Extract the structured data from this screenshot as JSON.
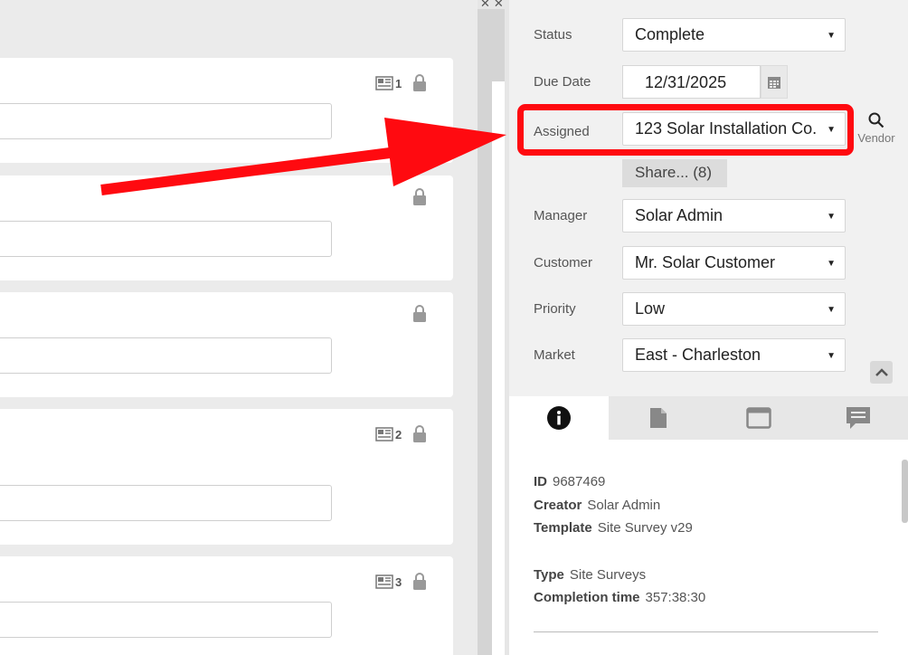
{
  "form": {
    "status": {
      "label": "Status",
      "value": "Complete"
    },
    "due_date": {
      "label": "Due Date",
      "value": "12/31/2025"
    },
    "assigned": {
      "label": "Assigned",
      "value": "123 Solar Installation Co."
    },
    "vendor_label": "Vendor",
    "share_label": "Share... (8)",
    "manager": {
      "label": "Manager",
      "value": "Solar Admin"
    },
    "customer": {
      "label": "Customer",
      "value": "Mr. Solar Customer"
    },
    "priority": {
      "label": "Priority",
      "value": "Low"
    },
    "market": {
      "label": "Market",
      "value": "East - Charleston"
    }
  },
  "cards": [
    {
      "badge": "1"
    },
    {
      "badge": ""
    },
    {
      "badge": ""
    },
    {
      "badge": "2"
    },
    {
      "badge": "3"
    }
  ],
  "tabs": [
    {
      "icon": "info-icon",
      "active": true
    },
    {
      "icon": "document-icon",
      "active": false
    },
    {
      "icon": "window-icon",
      "active": false
    },
    {
      "icon": "comment-icon",
      "active": false
    }
  ],
  "info": {
    "id": {
      "label": "ID",
      "value": "9687469"
    },
    "creator": {
      "label": "Creator",
      "value": "Solar Admin"
    },
    "template": {
      "label": "Template",
      "value": "Site Survey v29"
    },
    "type": {
      "label": "Type",
      "value": "Site Surveys"
    },
    "completion_time": {
      "label": "Completion time",
      "value": "357:38:30"
    }
  },
  "colors": {
    "highlight": "#ff0a10",
    "arrow": "#ff0a10"
  }
}
